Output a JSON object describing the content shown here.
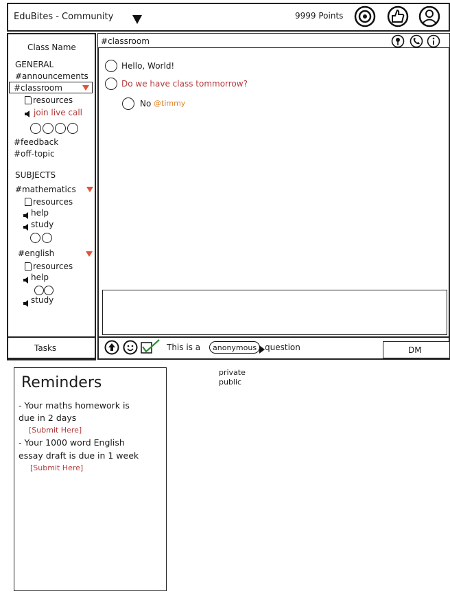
{
  "header": {
    "app_title": "EduBites - Community",
    "points": "9999 Points",
    "icons": [
      "eye-icon",
      "thumbs-up-icon",
      "profile-icon"
    ]
  },
  "sidebar": {
    "class_name": "Class Name",
    "general_heading": "GENERAL",
    "announcements": "#announcements",
    "classroom": "#classroom",
    "classroom_resources": "resources",
    "join_live_call": "join live call",
    "feedback": "#feedback",
    "off_topic": "#off-topic",
    "subjects_heading": "SUBJECTS",
    "mathematics": "#mathematics",
    "math_resources": "resources",
    "math_help": "help",
    "math_study": "study",
    "english": "#english",
    "english_resources": "resources",
    "english_help": "help",
    "english_study": "study",
    "tasks": "Tasks"
  },
  "channel": {
    "name": "#classroom",
    "icons": [
      "pin-icon",
      "phone-icon",
      "info-icon"
    ]
  },
  "messages": [
    {
      "text": "Hello, World!"
    },
    {
      "text": "Do we have class tommorrow?"
    },
    {
      "text": "No",
      "mention": "@timmy"
    }
  ],
  "composer": {
    "anonymous_prefix": "This is a",
    "anonymous_option": "anonymous",
    "anonymous_suffix": "question",
    "dropdown_options": [
      "private",
      "public"
    ],
    "dm_label": "DM",
    "anonymous_checked": true
  },
  "reminders": {
    "title": "Reminders",
    "item1_line1": "- Your maths homework is",
    "item1_line2": "due in 2 days",
    "item1_link": "[Submit Here]",
    "item2_line1": "- Your 1000 word English",
    "item2_line2": "essay draft is due in 1 week",
    "item2_link": "[Submit Here]"
  },
  "colors": {
    "accent_red": "#b33a3a",
    "mention_orange": "#d9822b",
    "flag": "#e0533a",
    "check_green": "#2e8b3a"
  }
}
